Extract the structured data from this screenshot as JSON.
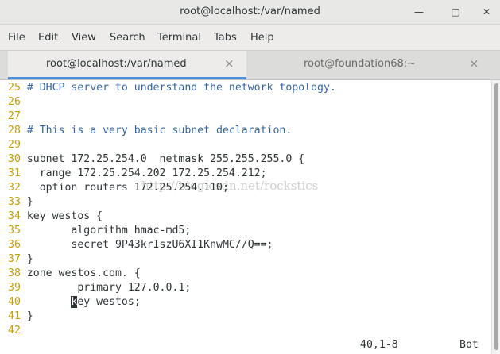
{
  "window": {
    "title": "root@localhost:/var/named",
    "minimize_icon": "minimize-icon",
    "maximize_icon": "maximize-icon",
    "close_icon": "close-icon"
  },
  "menubar": {
    "items": [
      "File",
      "Edit",
      "View",
      "Search",
      "Terminal",
      "Tabs",
      "Help"
    ]
  },
  "tabs": [
    {
      "label": "root@localhost:/var/named",
      "active": true
    },
    {
      "label": "root@foundation68:~",
      "active": false
    }
  ],
  "tab_close_glyph": "×",
  "editor": {
    "lines": [
      {
        "num": "25",
        "text": "# DHCP server to understand the network topology.",
        "comment": true
      },
      {
        "num": "26",
        "text": "",
        "comment": false
      },
      {
        "num": "27",
        "text": "",
        "comment": false
      },
      {
        "num": "28",
        "text": "# This is a very basic subnet declaration.",
        "comment": true
      },
      {
        "num": "29",
        "text": "",
        "comment": false
      },
      {
        "num": "30",
        "text": "subnet 172.25.254.0  netmask 255.255.255.0 {",
        "comment": false
      },
      {
        "num": "31",
        "text": "  range 172.25.254.202 172.25.254.212;",
        "comment": false
      },
      {
        "num": "32",
        "text": "  option routers 172.25.254.110;",
        "comment": false
      },
      {
        "num": "33",
        "text": "}",
        "comment": false
      },
      {
        "num": "34",
        "text": "key westos {",
        "comment": false
      },
      {
        "num": "35",
        "text": "       algorithm hmac-md5;",
        "comment": false
      },
      {
        "num": "36",
        "text": "       secret 9P43krIszU6XI1KnwMC//Q==;",
        "comment": false
      },
      {
        "num": "37",
        "text": "}",
        "comment": false
      },
      {
        "num": "38",
        "text": "zone westos.com. {",
        "comment": false
      },
      {
        "num": "39",
        "text": "        primary 127.0.0.1;",
        "comment": false
      },
      {
        "num": "40",
        "text_before": "       ",
        "cursor_char": "k",
        "text_after": "ey westos;",
        "comment": false,
        "has_cursor": true
      },
      {
        "num": "41",
        "text": "}",
        "comment": false
      },
      {
        "num": "42",
        "text": "",
        "comment": false
      }
    ],
    "status_position": "40,1-8",
    "status_scroll": "Bot"
  },
  "watermark": "http://blog.csdn.net/rockstics",
  "colors": {
    "line_number": "#c4a000",
    "comment": "#3465a4",
    "text": "#2e3436",
    "tab_accent": "#4a90d9"
  }
}
